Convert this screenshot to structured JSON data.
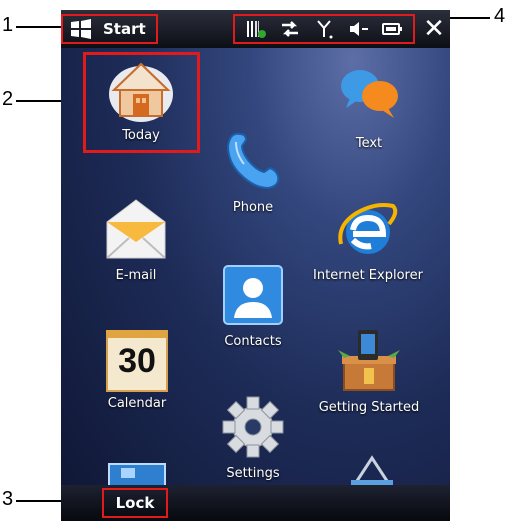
{
  "callouts": {
    "c1": "1",
    "c2": "2",
    "c3": "3",
    "c4": "4"
  },
  "taskbar": {
    "start_label": "Start",
    "close_label": "✕"
  },
  "status_icons": [
    "signal-bars-icon",
    "data-connection-icon",
    "antenna-icon",
    "speaker-muted-icon",
    "battery-icon"
  ],
  "tiles": {
    "today": "Today",
    "text": "Text",
    "phone": "Phone",
    "email": "E-mail",
    "internet_explorer": "Internet Explorer",
    "contacts": "Contacts",
    "calendar": "Calendar",
    "calendar_date": "30",
    "getting_started": "Getting Started",
    "settings": "Settings"
  },
  "bottom": {
    "lock_label": "Lock"
  },
  "colors": {
    "highlight": "#e11b1b",
    "background": "#1d2b57"
  }
}
